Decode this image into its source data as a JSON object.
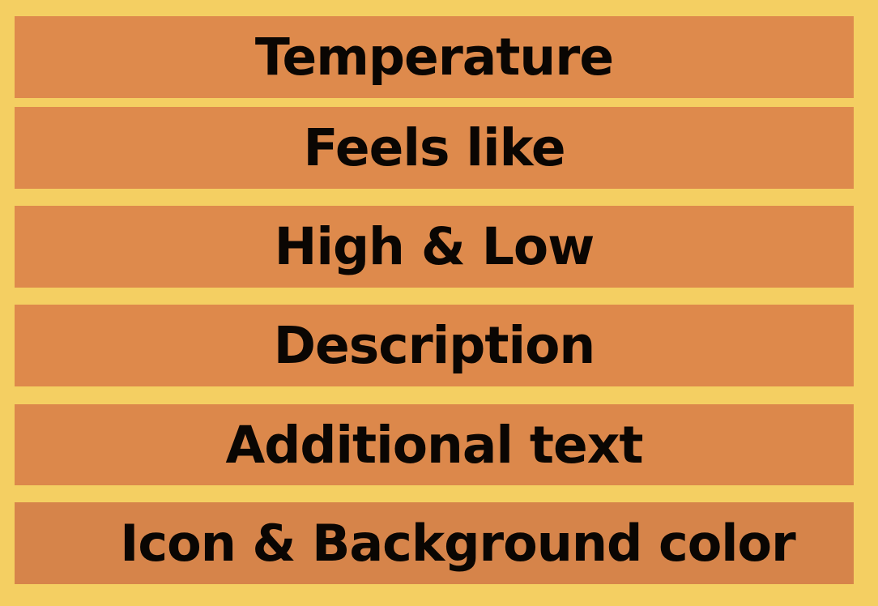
{
  "items": [
    {
      "label": "Temperature"
    },
    {
      "label": "Feels like"
    },
    {
      "label": "High & Low"
    },
    {
      "label": "Description"
    },
    {
      "label": "Additional text"
    },
    {
      "label": "Icon & Background color"
    }
  ],
  "colors": {
    "background": "#f4cf62",
    "bar": "#de8a4c",
    "text": "#0a0603"
  }
}
